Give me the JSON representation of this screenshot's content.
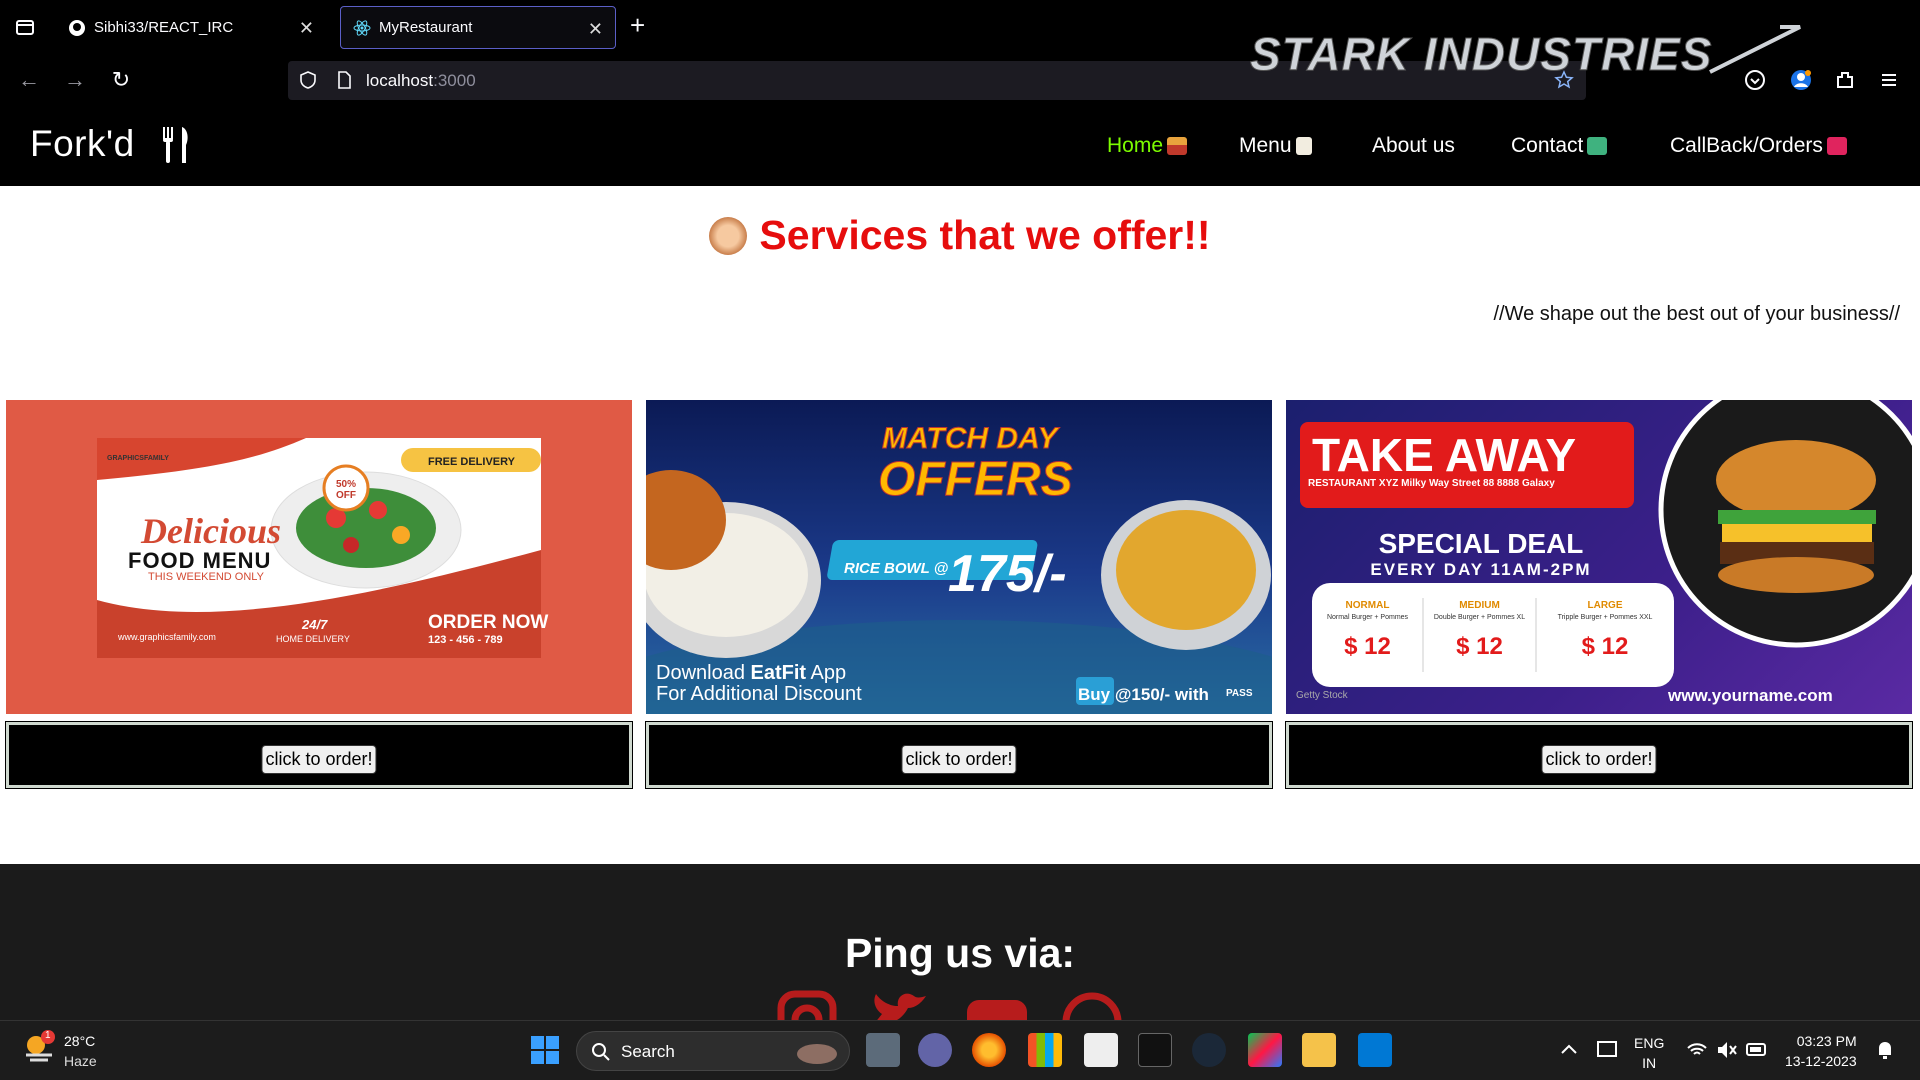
{
  "browser": {
    "tabs": [
      {
        "title": "Sibhi33/REACT_IRC",
        "icon": "github-icon",
        "active": false
      },
      {
        "title": "MyRestaurant",
        "icon": "react-icon",
        "active": true
      }
    ],
    "url_host": "localhost",
    "url_port": ":3000",
    "overlay_logo": "STARK INDUSTRIES"
  },
  "site": {
    "logo": "Fork'd",
    "nav": [
      {
        "label": "Home",
        "icon": "house-emoji",
        "active": true
      },
      {
        "label": "Menu",
        "icon": "scroll-emoji"
      },
      {
        "label": "About us"
      },
      {
        "label": "Contact",
        "icon": "computer-emoji"
      },
      {
        "label": "CallBack/Orders",
        "icon": "telephone-emoji"
      }
    ],
    "services_title": "Services that we offer!!",
    "tagline": "//We shape out the best out of your business//",
    "cards": [
      {
        "banner": {
          "brand": "GRAPHICSFAMILY",
          "badge_top": "FREE DELIVERY",
          "discount": "50% OFF",
          "headline": "Delicious",
          "subheadline": "FOOD MENU",
          "note": "THIS WEEKEND ONLY",
          "website": "www.graphicsfamily.com",
          "hours": "24/7",
          "hours_label": "HOME DELIVERY",
          "cta": "ORDER NOW",
          "phone": "123 - 456 - 789"
        },
        "button": "click to order!"
      },
      {
        "banner": {
          "headline_1": "MATCH DAY",
          "headline_2": "OFFERS",
          "deal_label": "RICE BOWL @",
          "deal_price": "175/-",
          "app_text_1": "Download",
          "app_name": "EatFit",
          "app_text_2": "App",
          "app_text_3": "For Additional Discount",
          "buy_text": "Buy @150/- with",
          "pass": "PASS"
        },
        "button": "click to order!"
      },
      {
        "banner": {
          "headline": "TAKE AWAY",
          "address": "RESTAURANT XYZ Milky Way Street 88 8888 Galaxy",
          "special": "SPECIAL DEAL",
          "schedule": "EVERY DAY 11AM-2PM",
          "sizes": [
            {
              "name": "NORMAL",
              "desc": "Normal Burger + Pommes",
              "price": "$ 12"
            },
            {
              "name": "MEDIUM",
              "desc": "Double Burger + Pommes XL",
              "price": "$ 12"
            },
            {
              "name": "LARGE",
              "desc": "Tripple Burger + Pommes XXL",
              "price": "$ 12"
            }
          ],
          "stock": "Getty Stock",
          "website": "www.yourname.com"
        },
        "button": "click to order!"
      }
    ],
    "footer_title": "Ping us via:",
    "social": [
      "instagram-icon",
      "twitter-icon",
      "youtube-icon",
      "whatsapp-icon"
    ]
  },
  "taskbar": {
    "weather_temp": "28°C",
    "weather_cond": "Haze",
    "weather_badge": "1",
    "search": "Search",
    "lang_1": "ENG",
    "lang_2": "IN",
    "time": "03:23 PM",
    "date": "13-12-2023"
  }
}
